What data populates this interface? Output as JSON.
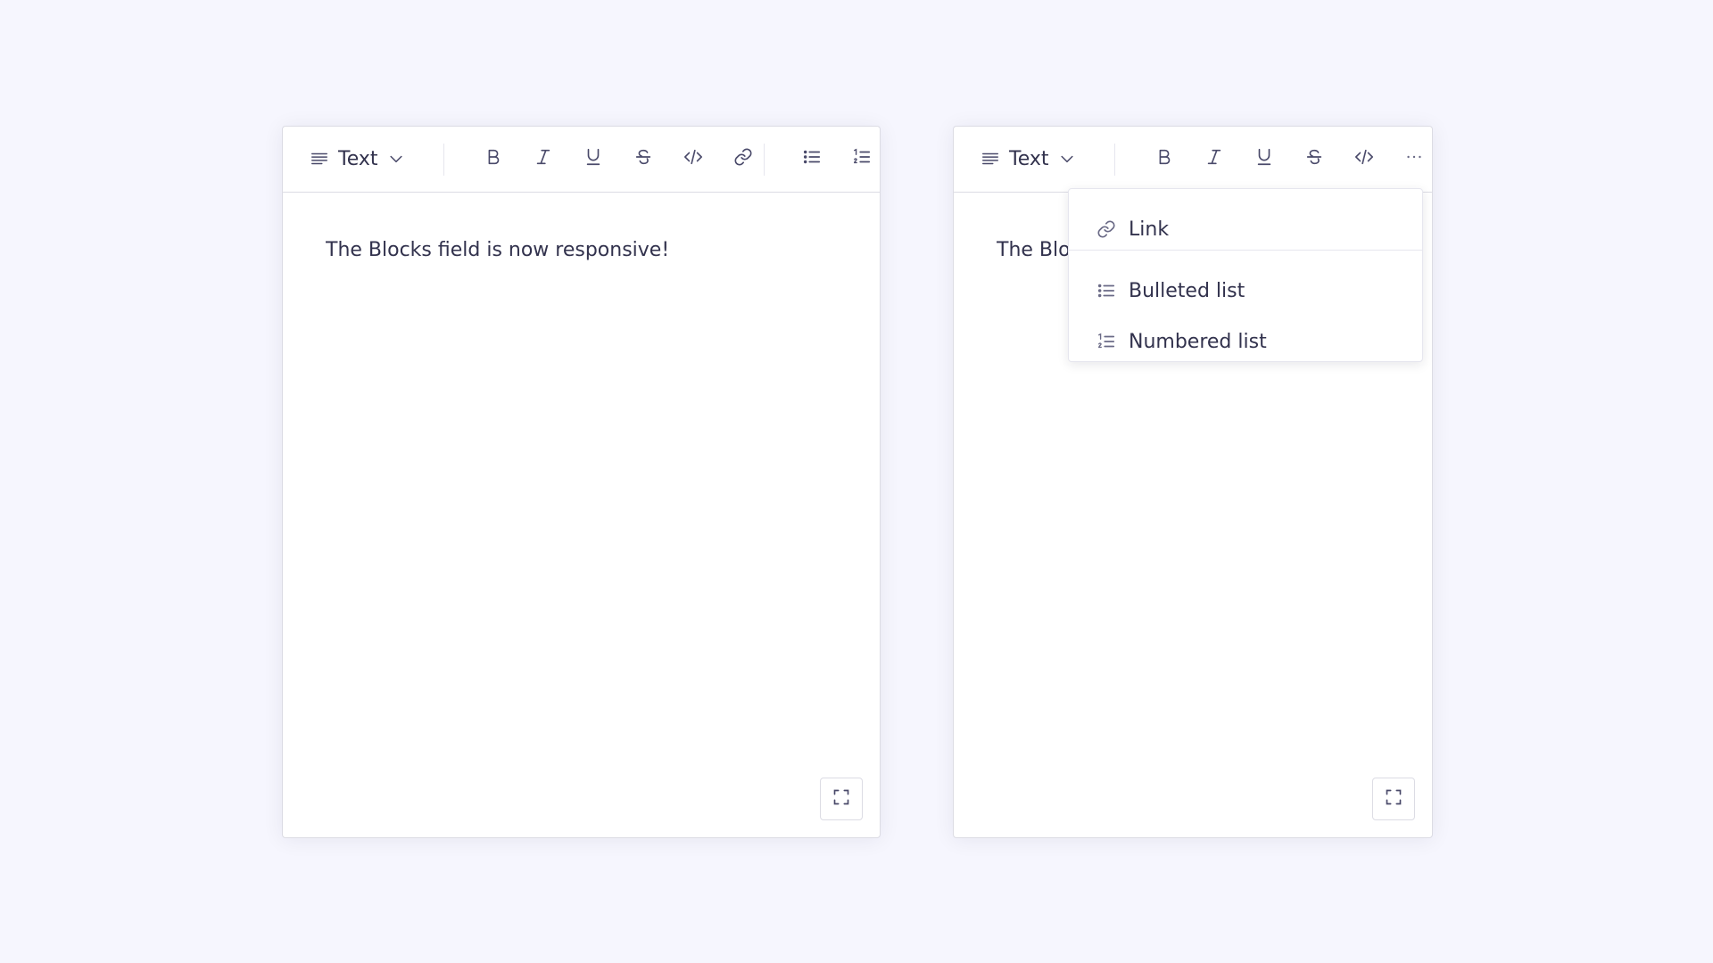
{
  "colors": {
    "background": "#f6f6fe",
    "text": "#32324d",
    "icon": "#4a4a6a",
    "border": "#dcdce4"
  },
  "editor_left": {
    "block_type_label": "Text",
    "block_type_icon": "paragraph-icon",
    "toolbar_icons": [
      "bold-icon",
      "italic-icon",
      "underline-icon",
      "strikethrough-icon",
      "code-icon",
      "link-icon",
      "bulleted-list-icon",
      "numbered-list-icon"
    ],
    "content_text": "The Blocks field is now responsive!",
    "expand_icon": "expand-icon"
  },
  "editor_right": {
    "block_type_label": "Text",
    "block_type_icon": "paragraph-icon",
    "toolbar_icons": [
      "bold-icon",
      "italic-icon",
      "underline-icon",
      "strikethrough-icon",
      "code-icon",
      "more-icon"
    ],
    "content_text": "The Blocks field is now responsive!",
    "expand_icon": "expand-icon"
  },
  "more_menu": {
    "items": [
      {
        "label": "Link",
        "icon": "link-icon"
      },
      {
        "label": "Bulleted list",
        "icon": "bulleted-list-icon"
      },
      {
        "label": "Numbered list",
        "icon": "numbered-list-icon"
      }
    ]
  }
}
